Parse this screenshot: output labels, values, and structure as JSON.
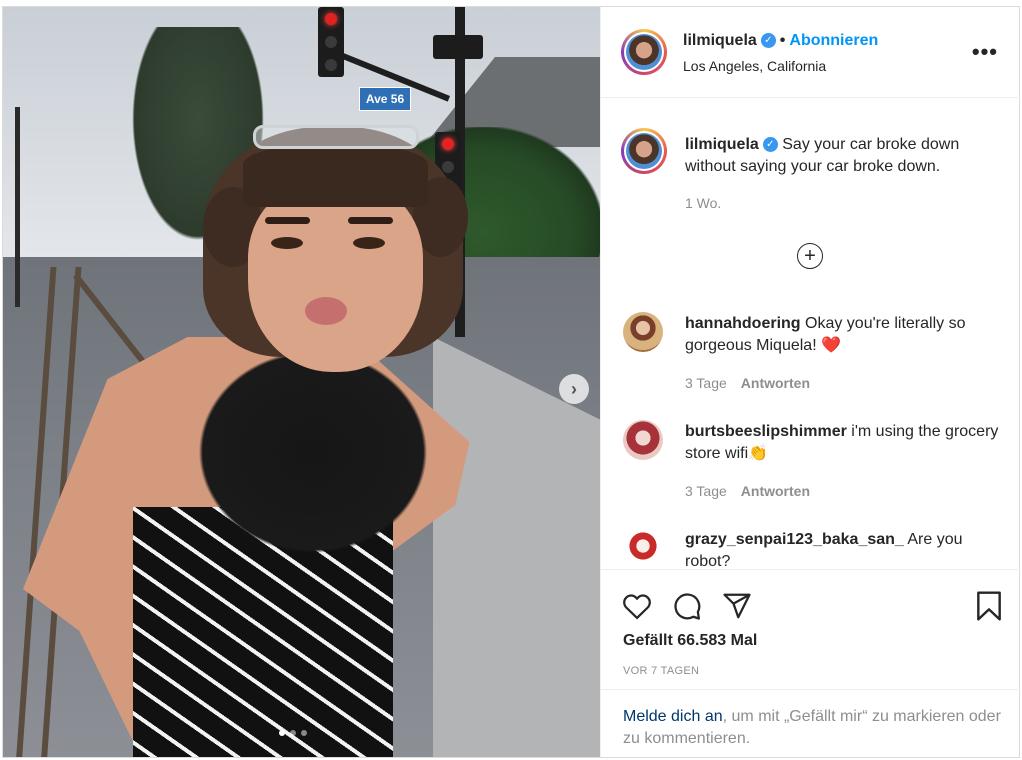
{
  "post": {
    "street_sign": "Ave 56",
    "carousel_dots": 3,
    "carousel_active": 1
  },
  "header": {
    "username": "lilmiquela",
    "separator": "•",
    "follow_label": "Abonnieren",
    "location": "Los Angeles, California",
    "more_label": "•••"
  },
  "caption": {
    "username": "lilmiquela",
    "text": "Say your car broke down without saying your car broke down.",
    "time": "1 Wo."
  },
  "load_more": "+",
  "comments": [
    {
      "username": "hannahdoering",
      "text": "Okay you're literally so gorgeous Miquela! ❤️",
      "time": "3 Tage",
      "reply": "Antworten"
    },
    {
      "username": "burtsbeeslipshimmer",
      "text": "i'm using the grocery store wifi👏",
      "time": "3 Tage",
      "reply": "Antworten"
    },
    {
      "username": "grazy_senpai123_baka_san_",
      "text": "Are you robot?",
      "time": "",
      "reply": ""
    }
  ],
  "stats": {
    "likes": "Gefällt 66.583 Mal",
    "ago": "VOR 7 TAGEN"
  },
  "login": {
    "link": "Melde dich an",
    "rest": ", um mit „Gefällt mir“ zu markieren oder zu kommentieren."
  },
  "icons": {
    "like": "heart-icon",
    "comment": "comment-icon",
    "share": "share-icon",
    "save": "bookmark-icon",
    "verified": "verified-badge-icon",
    "next": "chevron-right-icon"
  },
  "colors": {
    "accent": "#0095f6",
    "verified": "#3897f0",
    "meta": "#8e8e8e",
    "text": "#262626",
    "link": "#00376b"
  }
}
